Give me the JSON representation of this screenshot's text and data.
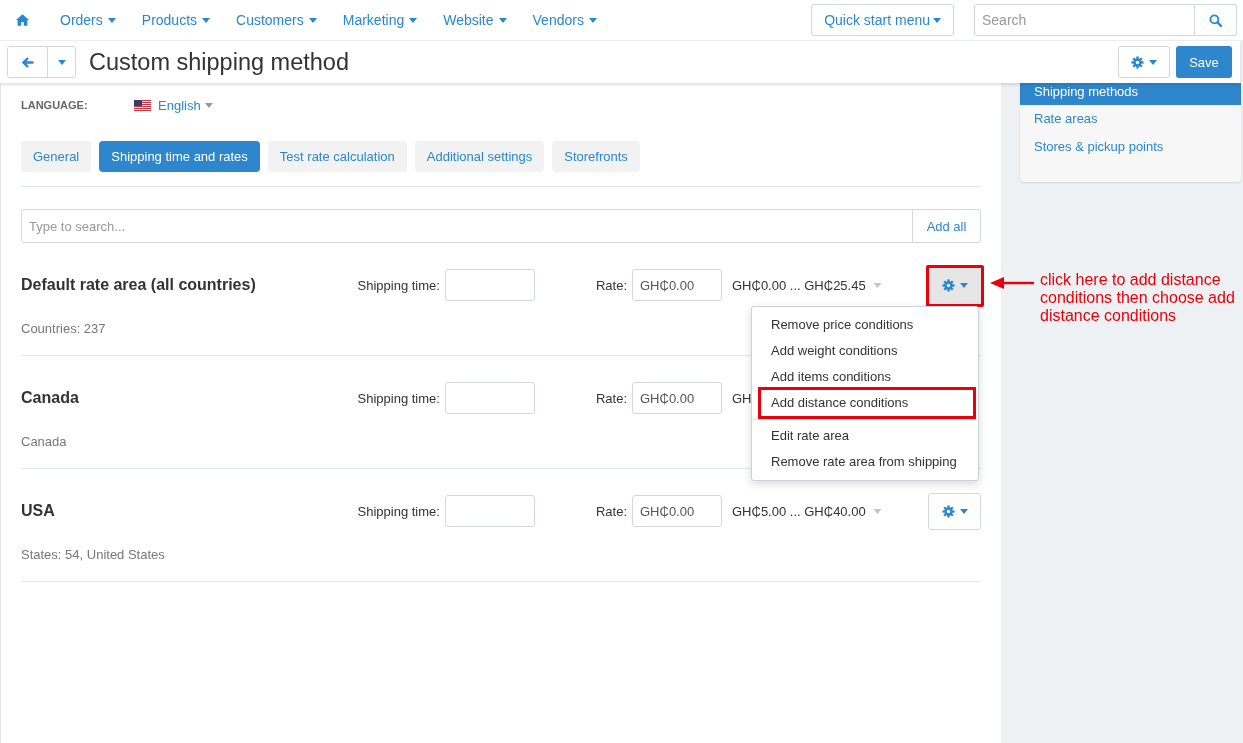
{
  "top_nav": {
    "items": [
      {
        "label": "Orders"
      },
      {
        "label": "Products"
      },
      {
        "label": "Customers"
      },
      {
        "label": "Marketing"
      },
      {
        "label": "Website"
      },
      {
        "label": "Vendors"
      }
    ],
    "quick_start": "Quick start menu",
    "search": {
      "placeholder": "Search"
    }
  },
  "page_header": {
    "title": "Custom shipping method",
    "save": "Save"
  },
  "language": {
    "label": "LANGUAGE:",
    "value": "English"
  },
  "tabs": [
    {
      "label": "General",
      "selected": false
    },
    {
      "label": "Shipping time and rates",
      "selected": true
    },
    {
      "label": "Test rate calculation",
      "selected": false
    },
    {
      "label": "Additional settings",
      "selected": false
    },
    {
      "label": "Storefronts",
      "selected": false
    }
  ],
  "search": {
    "placeholder": "Type to search...",
    "button": "Add all"
  },
  "rate_areas": [
    {
      "name": "Default rate area (all countries)",
      "time_label": "Shipping time:",
      "rate_label": "Rate:",
      "rate": "GH₵0.00",
      "range": "GH₵0.00 ... GH₵25.45",
      "details": "Countries: 237",
      "covered": false,
      "menu_open": true,
      "highlighted": true
    },
    {
      "name": "Canada",
      "time_label": "Shipping time:",
      "rate_label": "Rate:",
      "rate": "GH₵0.00",
      "range": "GH",
      "details": "Canada",
      "covered": true,
      "menu_open": false,
      "highlighted": false
    },
    {
      "name": "USA",
      "time_label": "Shipping time:",
      "rate_label": "Rate:",
      "rate": "GH₵0.00",
      "range": "GH₵5.00 ... GH₵40.00",
      "details": "States: 54, United States",
      "covered": false,
      "menu_open": false,
      "highlighted": false
    }
  ],
  "actions_menu": {
    "groups": [
      {
        "items": [
          {
            "label": "Remove price conditions",
            "highlighted": false
          },
          {
            "label": "Add weight conditions",
            "highlighted": false
          },
          {
            "label": "Add items conditions",
            "highlighted": false
          },
          {
            "label": "Add distance conditions",
            "highlighted": true
          }
        ]
      },
      {
        "items": [
          {
            "label": "Edit rate area",
            "highlighted": false
          },
          {
            "label": "Remove rate area from shipping",
            "highlighted": false
          }
        ]
      }
    ]
  },
  "sidebar": {
    "items": [
      {
        "label": "Shipping methods",
        "selected": true
      },
      {
        "label": "Rate areas",
        "selected": false
      },
      {
        "label": "Stores & pickup points",
        "selected": false
      }
    ]
  },
  "annotation": {
    "text": "click here to add distance conditions then choose add distance conditions"
  }
}
